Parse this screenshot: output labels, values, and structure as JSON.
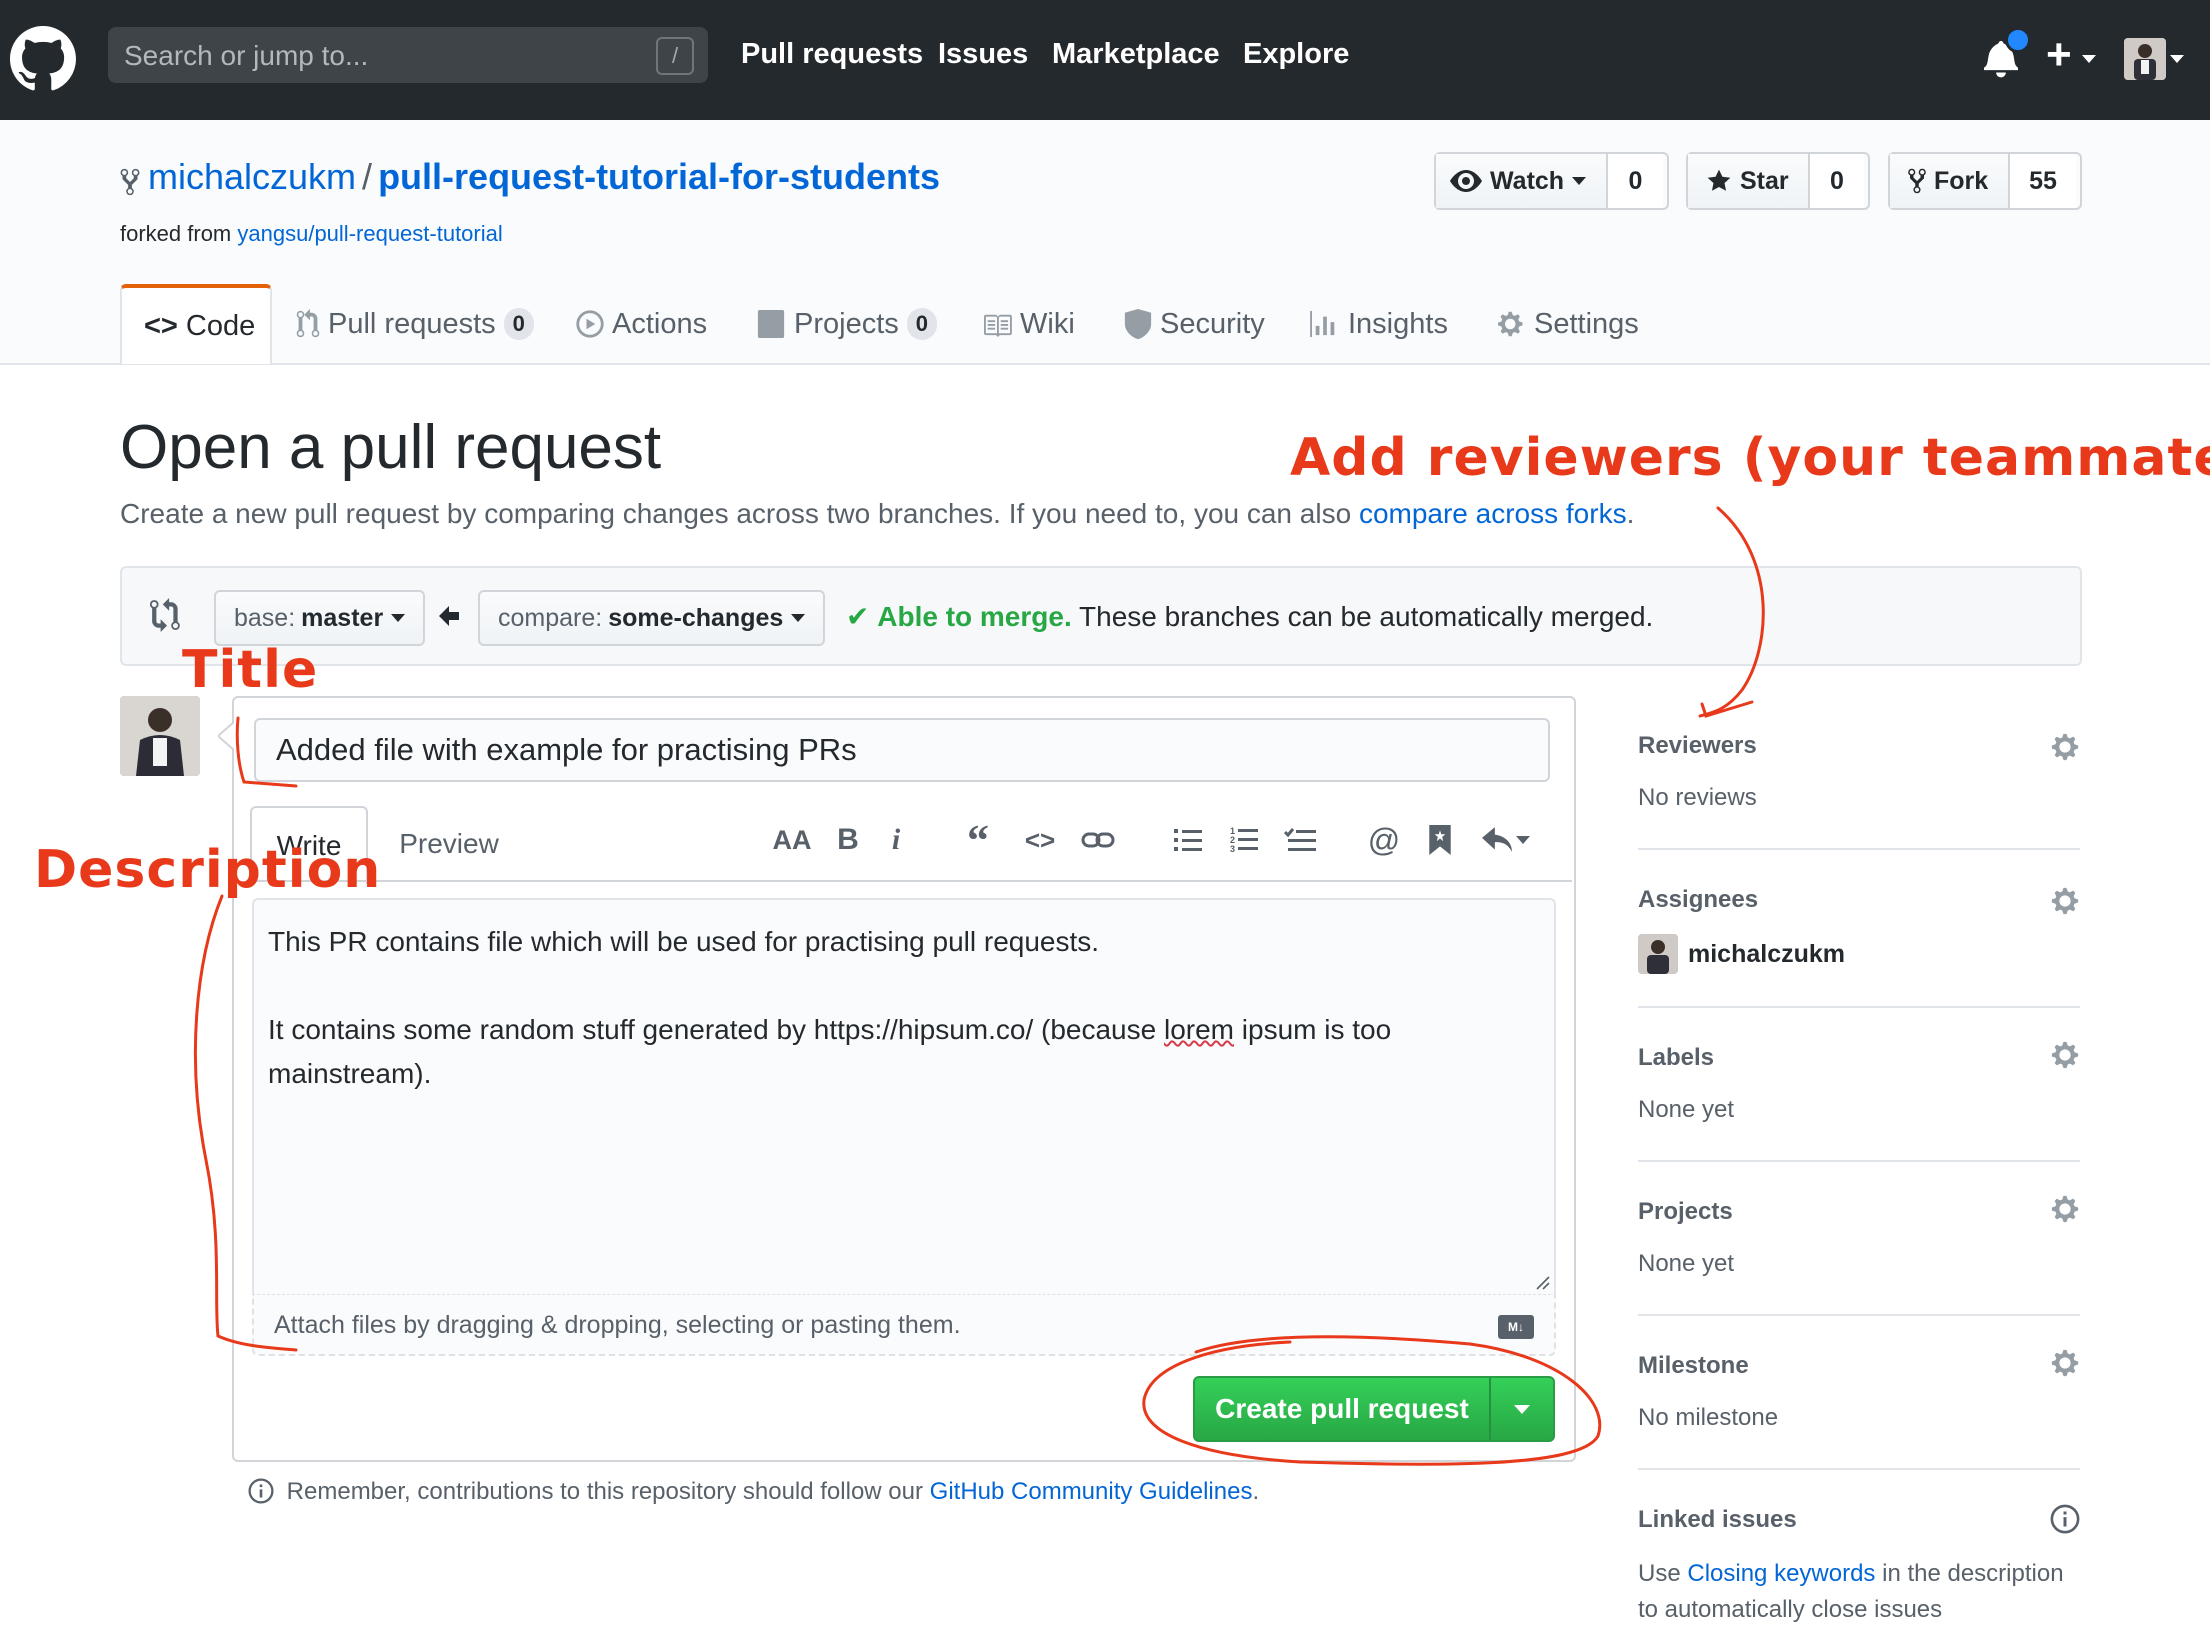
{
  "header": {
    "search_placeholder": "Search or jump to...",
    "search_shortcut": "/",
    "nav": [
      "Pull requests",
      "Issues",
      "Marketplace",
      "Explore"
    ],
    "plus_label": "+"
  },
  "repo": {
    "owner": "michalczukm",
    "separator": "/",
    "name": "pull-request-tutorial-for-students",
    "forked_prefix": "forked from",
    "forked_source": "yangsu/pull-request-tutorial",
    "watch_label": "Watch",
    "watch_count": "0",
    "star_label": "Star",
    "star_count": "0",
    "fork_label": "Fork",
    "fork_count": "55"
  },
  "tabs": {
    "code": "Code",
    "pulls": "Pull requests",
    "pulls_count": "0",
    "actions": "Actions",
    "projects": "Projects",
    "projects_count": "0",
    "wiki": "Wiki",
    "security": "Security",
    "insights": "Insights",
    "settings": "Settings"
  },
  "page": {
    "title": "Open a pull request",
    "lead": "Create a new pull request by comparing changes across two branches. If you need to, you can also",
    "lead_link": "compare across forks",
    "lead_end": "."
  },
  "range": {
    "base_prefix": "base:",
    "base_branch": "master",
    "compare_prefix": "compare:",
    "compare_branch": "some-changes",
    "merge_ok": "Able to merge.",
    "merge_text": "These branches can be automatically merged."
  },
  "form": {
    "title_value": "Added file with example for practising PRs",
    "write_tab": "Write",
    "preview_tab": "Preview",
    "toolbar": {
      "heading": "AA",
      "bold": "B",
      "italic": "i",
      "quote": "“",
      "code": "<>"
    },
    "body_line1": "This PR contains file which will be used for practising pull requests.",
    "body_line2_a": "It contains some random stuff generated by https://hipsum.co/ (because ",
    "body_line2_b": "lorem",
    "body_line2_c": " ipsum is too",
    "body_line3": "mainstream).",
    "attach_text": "Attach files by dragging & dropping, selecting or pasting them.",
    "markdown_badge": "M↓",
    "create_button": "Create pull request"
  },
  "remember": {
    "text": "Remember, contributions to this repository should follow our",
    "link": "GitHub Community Guidelines",
    "end": "."
  },
  "sidebar": {
    "reviewers_title": "Reviewers",
    "reviewers_value": "No reviews",
    "assignees_title": "Assignees",
    "assignee_name": "michalczukm",
    "labels_title": "Labels",
    "labels_value": "None yet",
    "projects_title": "Projects",
    "projects_value": "None yet",
    "milestone_title": "Milestone",
    "milestone_value": "No milestone",
    "linked_title": "Linked issues",
    "linked_pre": "Use",
    "linked_link": "Closing keywords",
    "linked_mid": "in the description",
    "linked_end": "to automatically close issues"
  },
  "annotations": {
    "reviewers": "Add reviewers (your teammates)",
    "title": "Title",
    "description": "Description"
  },
  "colors": {
    "header_bg": "#24292e",
    "link": "#0366d6",
    "success": "#28a745",
    "annotation": "#e8391b",
    "tab_accent": "#e36209"
  }
}
